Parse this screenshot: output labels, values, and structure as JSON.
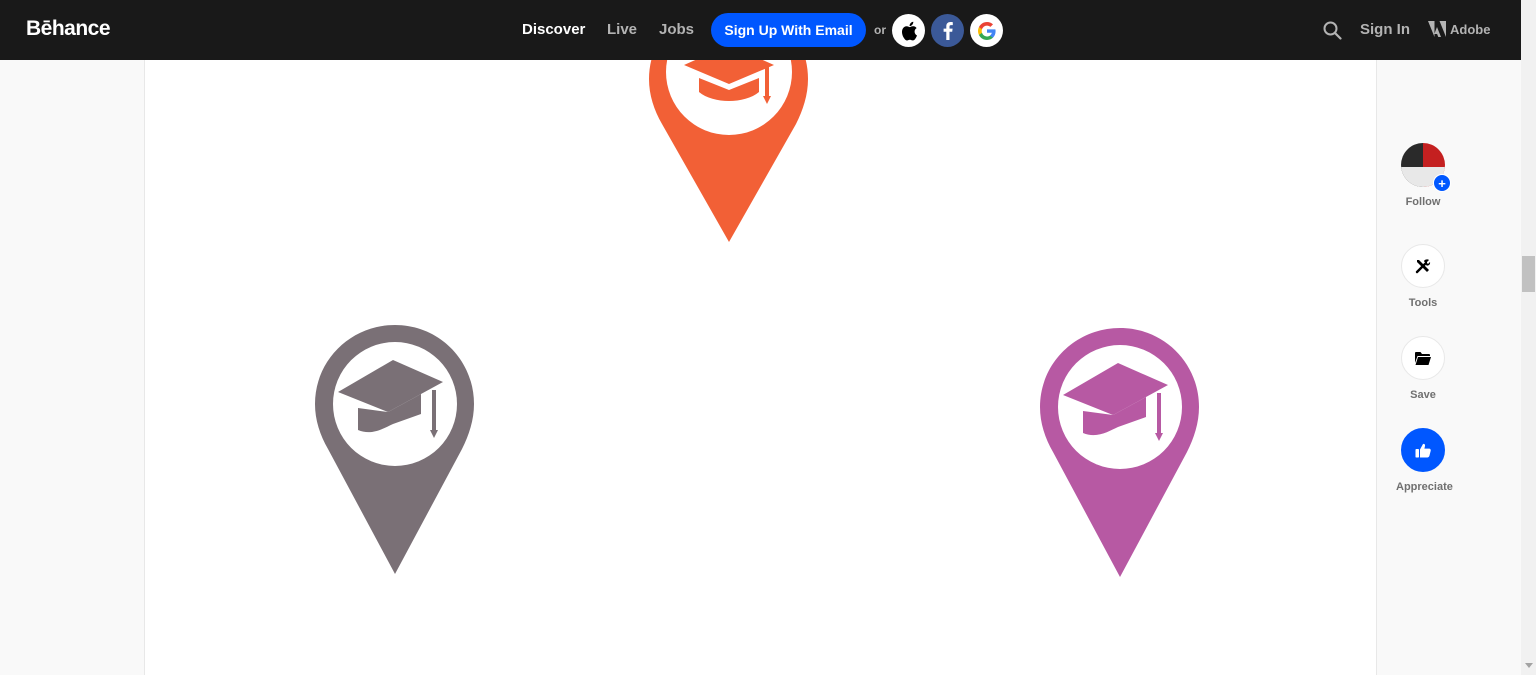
{
  "header": {
    "logo": "Bēhance",
    "nav": [
      {
        "label": "Discover",
        "active": true
      },
      {
        "label": "Live",
        "active": false
      },
      {
        "label": "Jobs",
        "active": false
      }
    ],
    "signup_label": "Sign Up With Email",
    "or_label": "or",
    "social": [
      "apple-icon",
      "facebook-icon",
      "google-icon"
    ],
    "signin_label": "Sign In",
    "adobe_label": "Adobe"
  },
  "project": {
    "pins": [
      {
        "name": "orange-location-pin",
        "color": "#f26036",
        "icon": "graduation-cap-icon"
      },
      {
        "name": "gray-location-pin",
        "color": "#7a7076",
        "icon": "graduation-cap-icon"
      },
      {
        "name": "magenta-location-pin",
        "color": "#b759a3",
        "icon": "graduation-cap-icon"
      }
    ]
  },
  "rail": {
    "follow_label": "Follow",
    "tools_label": "Tools",
    "save_label": "Save",
    "appreciate_label": "Appreciate"
  },
  "colors": {
    "accent": "#0057ff",
    "topbar": "#191919"
  }
}
